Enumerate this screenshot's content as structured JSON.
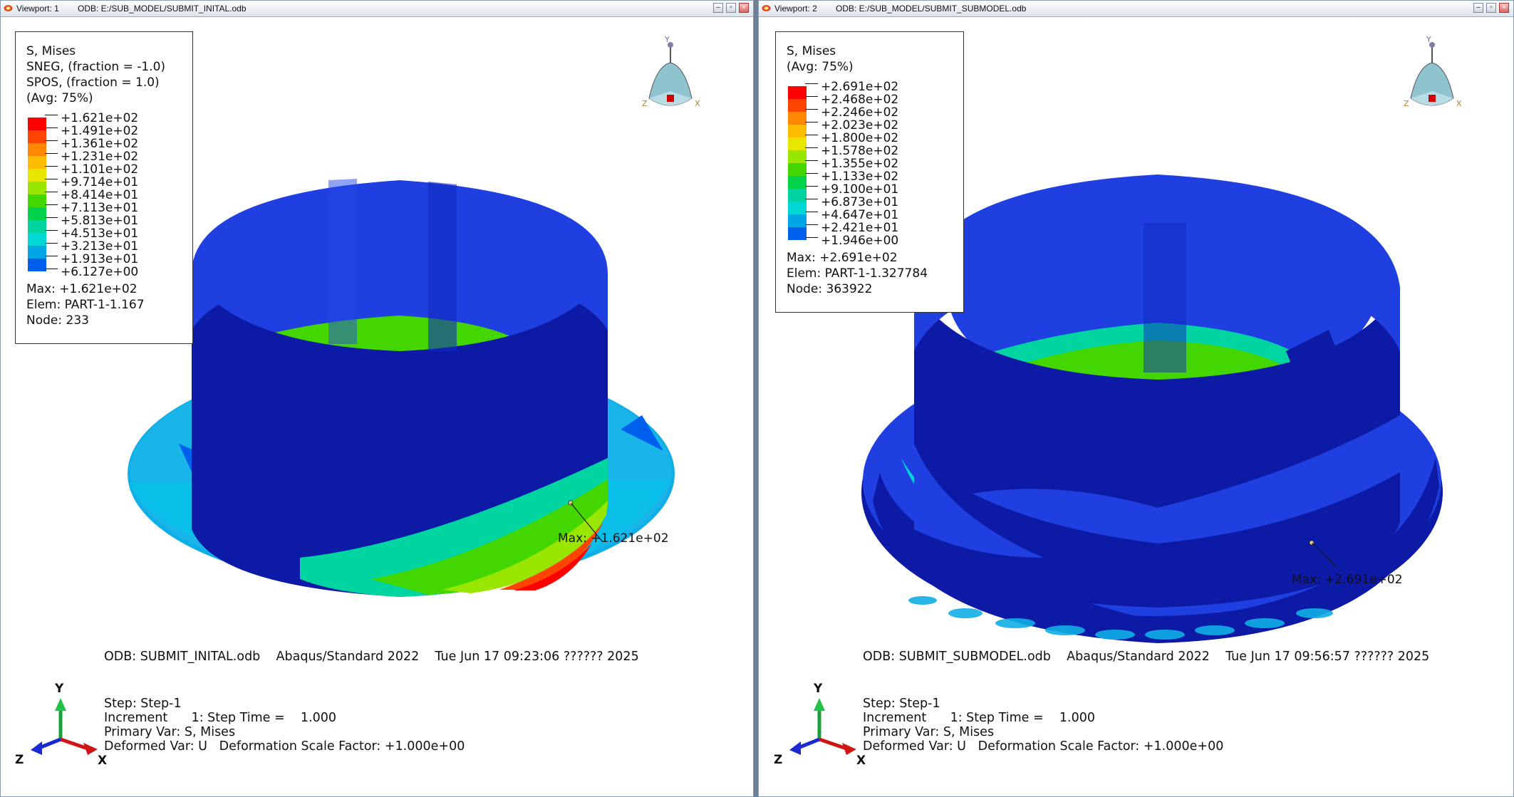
{
  "vp1": {
    "title_label": "Viewport: 1",
    "title_odb": "ODB: E:/SUB_MODEL/SUBMIT_INITAL.odb",
    "legend_header": [
      "S, Mises",
      "SNEG, (fraction = -1.0)",
      "SPOS, (fraction = 1.0)",
      "(Avg: 75%)"
    ],
    "legend_values": [
      "+1.621e+02",
      "+1.491e+02",
      "+1.361e+02",
      "+1.231e+02",
      "+1.101e+02",
      "+9.714e+01",
      "+8.414e+01",
      "+7.113e+01",
      "+5.813e+01",
      "+4.513e+01",
      "+3.213e+01",
      "+1.913e+01",
      "+6.127e+00"
    ],
    "max_info": [
      "Max: +1.621e+02",
      "  Elem: PART-1-1.167",
      "  Node: 233"
    ],
    "max_label": "Max: +1.621e+02",
    "odb_line": "ODB: SUBMIT_INITAL.odb    Abaqus/Standard 2022    Tue Jun 17 09:23:06 ?????? 2025",
    "step_lines": [
      "Step: Step-1",
      "Increment      1: Step Time =    1.000",
      "Primary Var: S, Mises",
      "Deformed Var: U   Deformation Scale Factor: +1.000e+00"
    ]
  },
  "vp2": {
    "title_label": "Viewport: 2",
    "title_odb": "ODB: E:/SUB_MODEL/SUBMIT_SUBMODEL.odb",
    "legend_header": [
      "S, Mises",
      "(Avg: 75%)"
    ],
    "legend_values": [
      "+2.691e+02",
      "+2.468e+02",
      "+2.246e+02",
      "+2.023e+02",
      "+1.800e+02",
      "+1.578e+02",
      "+1.355e+02",
      "+1.133e+02",
      "+9.100e+01",
      "+6.873e+01",
      "+4.647e+01",
      "+2.421e+01",
      "+1.946e+00"
    ],
    "max_info": [
      "Max: +2.691e+02",
      "  Elem: PART-1-1.327784",
      "  Node: 363922"
    ],
    "max_label": "Max: +2.691e+02",
    "odb_line": "ODB: SUBMIT_SUBMODEL.odb    Abaqus/Standard 2022    Tue Jun 17 09:56:57 ?????? 2025",
    "step_lines": [
      "Step: Step-1",
      "Increment      1: Step Time =    1.000",
      "Primary Var: S, Mises",
      "Deformed Var: U   Deformation Scale Factor: +1.000e+00"
    ]
  },
  "triad": {
    "x": "X",
    "y": "Y",
    "z": "Z"
  },
  "colors": {
    "contour": [
      "#ff0000",
      "#ff4400",
      "#ff8800",
      "#ffbb00",
      "#e6e600",
      "#99e600",
      "#44d600",
      "#00d24a",
      "#00d4a0",
      "#00d6d6",
      "#00a6e6",
      "#0060ee",
      "#0022dd"
    ],
    "ring_dark": "#0d1aa6",
    "ring_mid": "#1f3fe0",
    "flange_light": "#11aee6"
  }
}
